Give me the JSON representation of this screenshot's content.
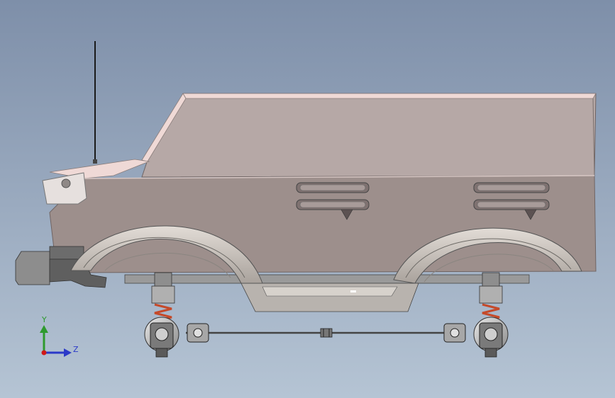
{
  "triad": {
    "y_label": "Y",
    "z_label": "Z",
    "y_color": "#2e9a2e",
    "z_color": "#2b39c8",
    "x_color": "#d01818"
  },
  "colors": {
    "background_top": "#7e8fa9",
    "background_bottom": "#b5c4d4",
    "body_side": "#9d8f8c",
    "body_upper": "#b6a8a6",
    "body_roof": "#efd9d6",
    "fender": "#cfc9c4",
    "chassis": "#9a9a9a",
    "spring": "#c54a2a",
    "hub": "#bdbdbd"
  }
}
